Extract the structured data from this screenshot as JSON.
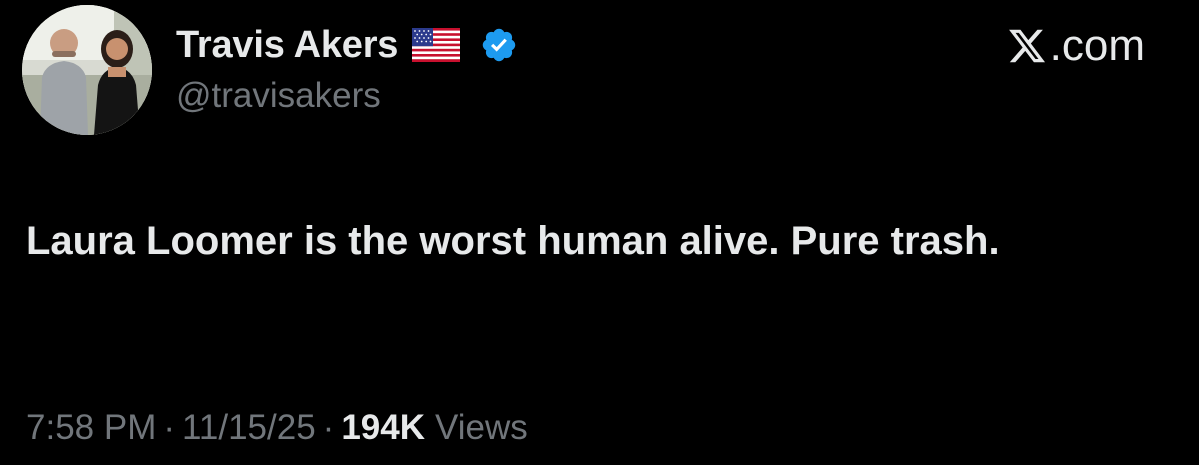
{
  "author": {
    "display_name": "Travis Akers",
    "handle": "@travisakers",
    "flag_icon": "us-flag-emoji",
    "verified_icon": "verified-badge-icon",
    "verified_color": "#1d9bf0"
  },
  "site": {
    "logo_icon": "x-logo-icon",
    "domain_suffix": ".com"
  },
  "tweet": {
    "text": "Laura Loomer is the worst human alive. Pure trash."
  },
  "meta": {
    "time": "7:58 PM",
    "separator": "·",
    "date": "11/15/25",
    "views_count": "194K",
    "views_label": "Views"
  },
  "colors": {
    "background": "#000000",
    "primary_text": "#e7e9ea",
    "secondary_text": "#71767b"
  }
}
